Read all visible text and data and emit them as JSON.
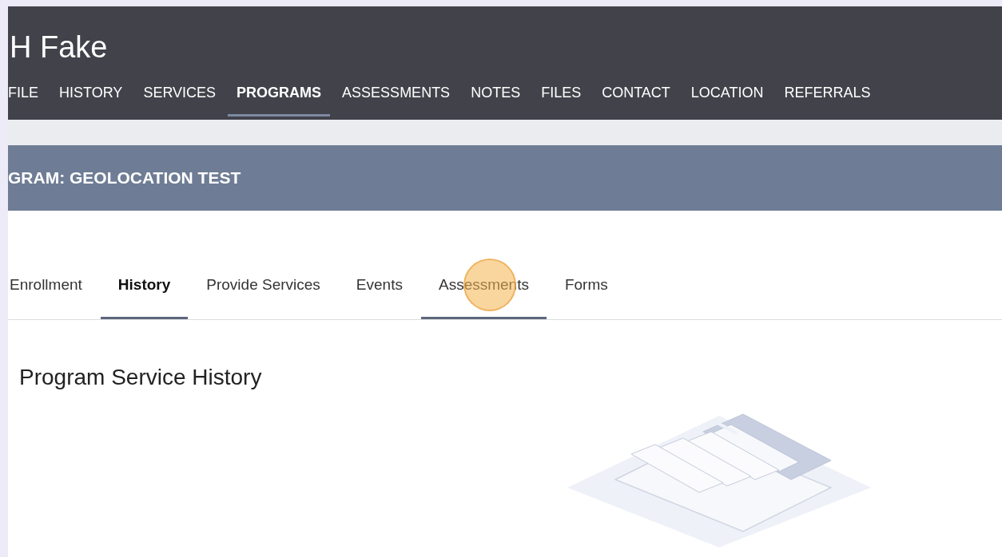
{
  "header": {
    "title": "H Fake"
  },
  "nav": [
    {
      "label": "FILE",
      "selected": false
    },
    {
      "label": "HISTORY",
      "selected": false
    },
    {
      "label": "SERVICES",
      "selected": false
    },
    {
      "label": "PROGRAMS",
      "selected": true
    },
    {
      "label": "ASSESSMENTS",
      "selected": false
    },
    {
      "label": "NOTES",
      "selected": false
    },
    {
      "label": "FILES",
      "selected": false
    },
    {
      "label": "CONTACT",
      "selected": false
    },
    {
      "label": "LOCATION",
      "selected": false
    },
    {
      "label": "REFERRALS",
      "selected": false
    }
  ],
  "banner": {
    "title": "GRAM: GEOLOCATION TEST"
  },
  "tabs": [
    {
      "label": "Enrollment",
      "selected": false,
      "hovered": false
    },
    {
      "label": "History",
      "selected": true,
      "hovered": false
    },
    {
      "label": "Provide Services",
      "selected": false,
      "hovered": false
    },
    {
      "label": "Events",
      "selected": false,
      "hovered": false
    },
    {
      "label": "Assessments",
      "selected": false,
      "hovered": true
    },
    {
      "label": "Forms",
      "selected": false,
      "hovered": false
    }
  ],
  "section": {
    "heading": "Program Service History"
  }
}
